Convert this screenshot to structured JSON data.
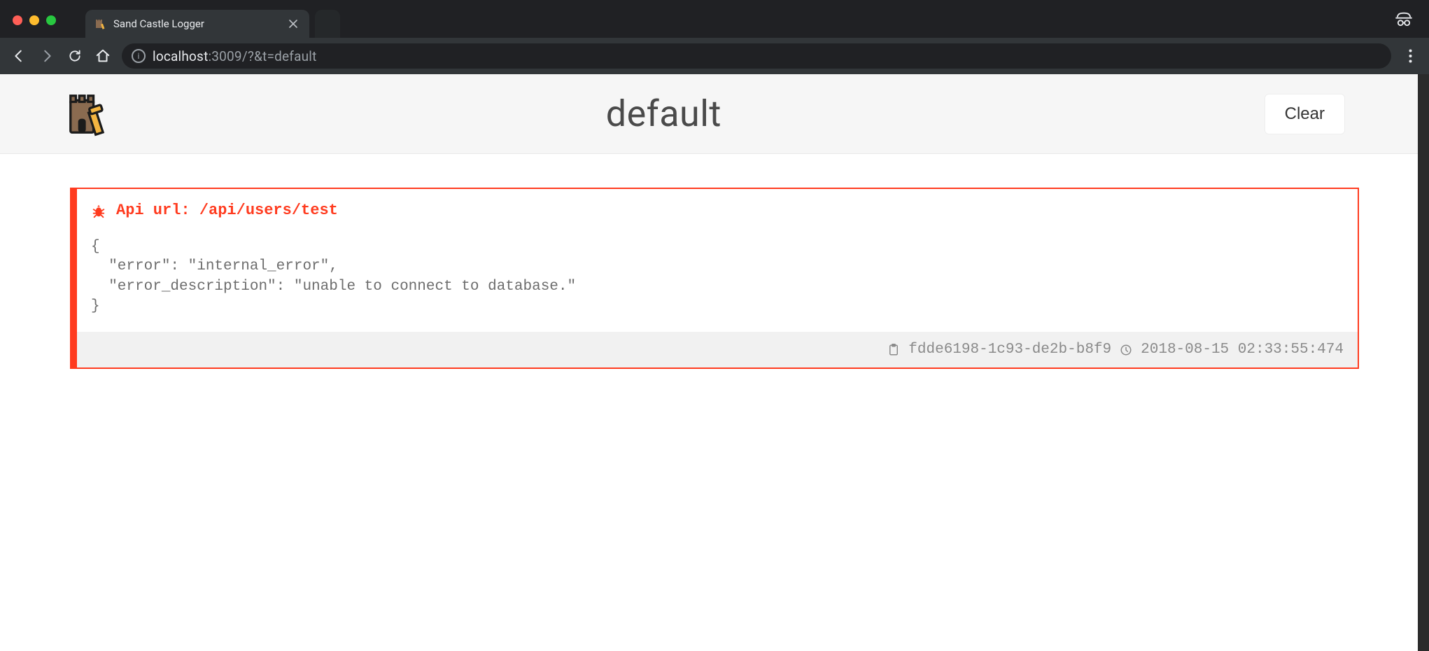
{
  "browser": {
    "tab_title": "Sand Castle Logger",
    "url_host": "localhost",
    "url_port": ":3009",
    "url_path": "/?&t=default"
  },
  "header": {
    "title": "default",
    "clear_label": "Clear"
  },
  "log": {
    "title": "Api url: /api/users/test",
    "body": "{\n  \"error\": \"internal_error\",\n  \"error_description\": \"unable to connect to database.\"\n}",
    "id": "fdde6198-1c93-de2b-b8f9",
    "timestamp": "2018-08-15 02:33:55:474"
  },
  "colors": {
    "error": "#ff3b1f",
    "chrome_bg": "#202124",
    "toolbar_bg": "#323639"
  }
}
